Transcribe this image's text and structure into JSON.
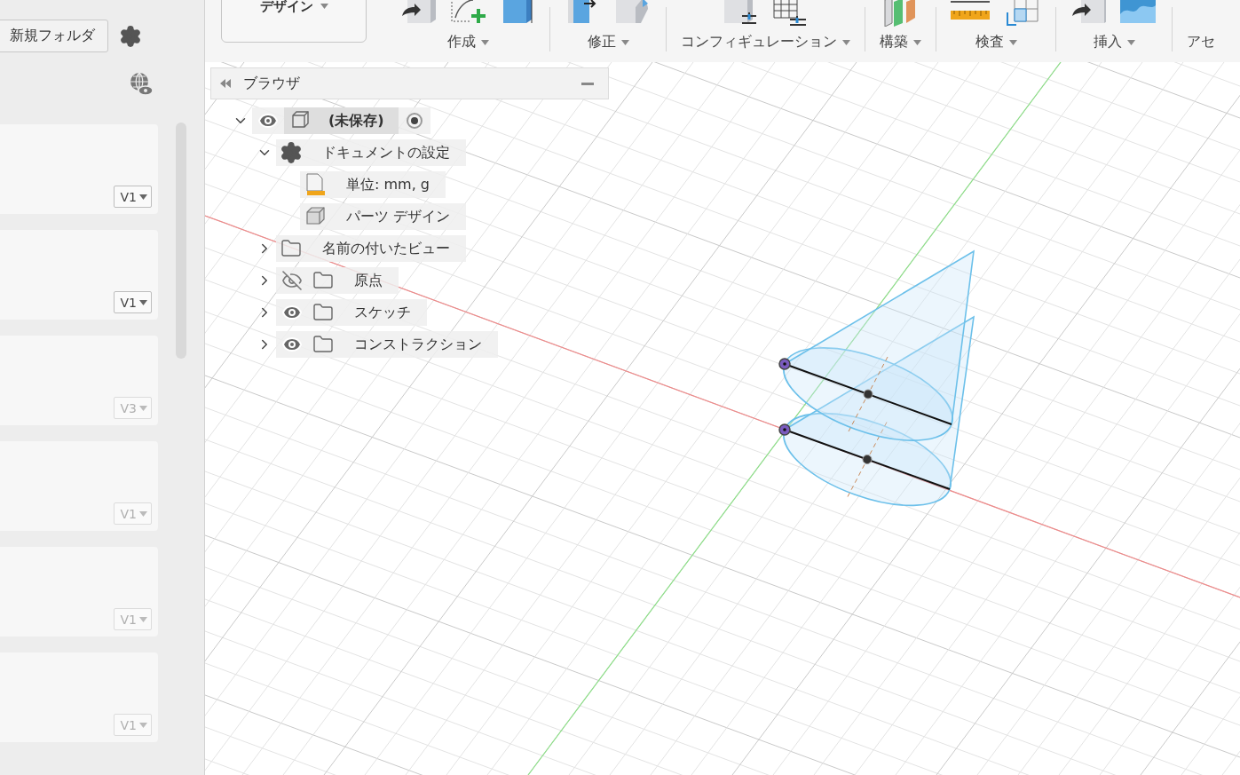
{
  "left_panel": {
    "new_folder_button": "新規フォルダ",
    "cards": [
      {
        "version": "V1",
        "disabled": false
      },
      {
        "version": "V1",
        "disabled": false
      },
      {
        "version": "V3",
        "disabled": true
      },
      {
        "version": "V1",
        "disabled": true
      },
      {
        "version": "V1",
        "disabled": true
      },
      {
        "version": "V1",
        "disabled": true
      }
    ]
  },
  "toolbar": {
    "workspace": "デザイン",
    "groups": [
      {
        "label": "作成"
      },
      {
        "label": "修正"
      },
      {
        "label": "コンフィギュレーション"
      },
      {
        "label": "構築"
      },
      {
        "label": "検査"
      },
      {
        "label": "挿入"
      },
      {
        "label": "アセ"
      }
    ]
  },
  "browser": {
    "title": "ブラウザ",
    "tree": [
      {
        "label": "(未保存)",
        "kind": "component",
        "expanded": true,
        "visible": true,
        "active": true,
        "children": [
          {
            "label": "ドキュメントの設定",
            "kind": "settings",
            "expanded": true,
            "children": [
              {
                "label": "単位: mm, g",
                "kind": "units"
              },
              {
                "label": "パーツ デザイン",
                "kind": "part"
              }
            ]
          },
          {
            "label": "名前の付いたビュー",
            "kind": "folder",
            "expanded": false
          },
          {
            "label": "原点",
            "kind": "folder",
            "expanded": false,
            "visible": false
          },
          {
            "label": "スケッチ",
            "kind": "folder",
            "expanded": false,
            "visible": true
          },
          {
            "label": "コンストラクション",
            "kind": "folder",
            "expanded": false,
            "visible": true
          }
        ]
      }
    ]
  }
}
